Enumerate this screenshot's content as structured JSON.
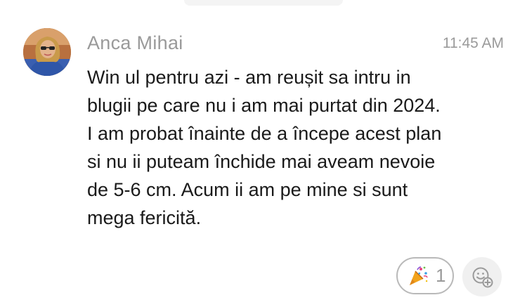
{
  "message": {
    "sender_name": "Anca Mihai",
    "timestamp": "11:45 AM",
    "avatar_icon": "user-photo-avatar",
    "text_lines": [
      "Win ul pentru azi - am reușit sa intru in",
      "blugii pe care nu i am mai purtat din 2024.",
      "I am probat înainte de a începe acest plan",
      "si nu ii puteam închide mai aveam nevoie",
      "de 5-6 cm. Acum ii am pe mine si sunt",
      "mega fericită."
    ]
  },
  "reactions": [
    {
      "emoji_icon": "party-popper-icon",
      "count": "1"
    }
  ],
  "add_reaction": {
    "icon": "add-emoji-reaction-icon"
  },
  "colors": {
    "text": "#1a1a1a",
    "muted": "#9a9a9a",
    "chip_border": "#b9b9b9",
    "add_reaction_bg": "#f0f0f0"
  }
}
